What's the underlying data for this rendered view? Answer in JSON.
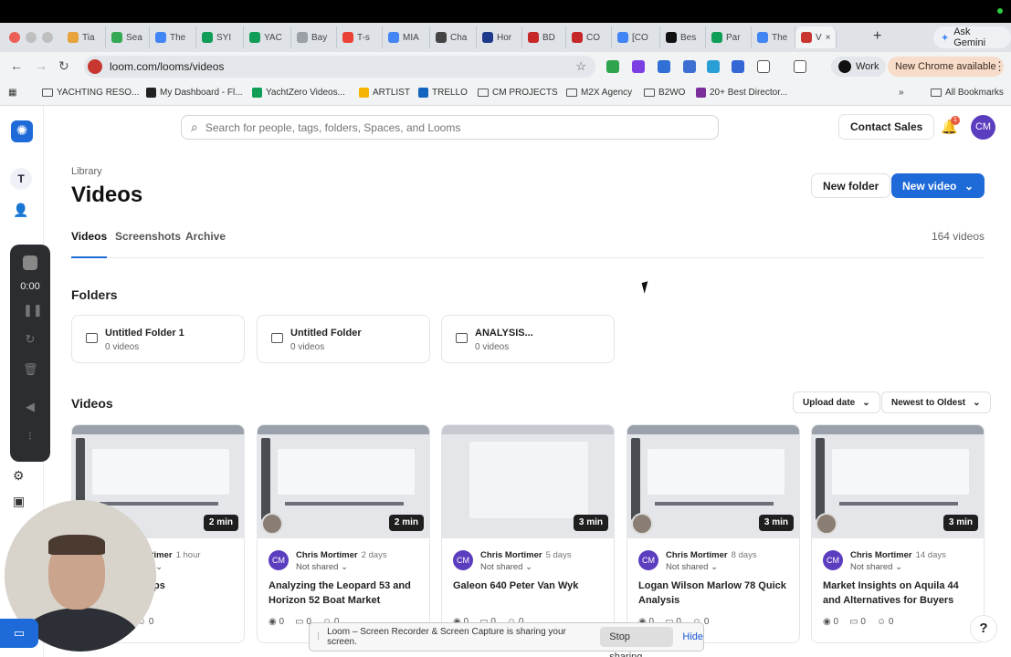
{
  "browser": {
    "tabs": [
      {
        "label": "Tia",
        "color": "#e8a33d"
      },
      {
        "label": "Sea",
        "color": "#34a853"
      },
      {
        "label": "The",
        "color": "#4285f4"
      },
      {
        "label": "SYI",
        "color": "#0f9d58"
      },
      {
        "label": "YAC",
        "color": "#0f9d58"
      },
      {
        "label": "Bay",
        "color": "#9aa0a6"
      },
      {
        "label": "T-s",
        "color": "#ea4335"
      },
      {
        "label": "MIA",
        "color": "#4285f4"
      },
      {
        "label": "Cha",
        "color": "#444444"
      },
      {
        "label": "Hor",
        "color": "#1e3a8a"
      },
      {
        "label": "BD",
        "color": "#c62828"
      },
      {
        "label": "CO",
        "color": "#c62828"
      },
      {
        "label": "[CO",
        "color": "#4285f4"
      },
      {
        "label": "Bes",
        "color": "#111111"
      },
      {
        "label": "Par",
        "color": "#0f9d58"
      },
      {
        "label": "The",
        "color": "#4285f4"
      },
      {
        "label": "V",
        "color": "#c7372f",
        "active": true
      }
    ],
    "ask_gemini": "Ask Gemini",
    "url": "loom.com/looms/videos",
    "profile": "Work",
    "update_notice": "New Chrome available",
    "bookmarks": [
      {
        "label": "YACHTING RESO...",
        "icon": "folder-icon"
      },
      {
        "label": "My Dashboard - Fl...",
        "icon": "asterisk-icon"
      },
      {
        "label": "YachtZero Videos...",
        "icon": "sheets-icon"
      },
      {
        "label": "ARTLIST",
        "icon": "artlist-icon"
      },
      {
        "label": "TRELLO",
        "icon": "trello-icon"
      },
      {
        "label": "CM PROJECTS",
        "icon": "folder-icon"
      },
      {
        "label": "M2X Agency",
        "icon": "folder-icon"
      },
      {
        "label": "B2WO",
        "icon": "folder-icon"
      },
      {
        "label": "20+ Best Director...",
        "icon": "site-icon"
      }
    ],
    "all_bookmarks": "All Bookmarks"
  },
  "sidebar": {
    "workspace_initial": "T"
  },
  "recorder": {
    "time": "0:00"
  },
  "header": {
    "search_placeholder": "Search for people, tags, folders, Spaces, and Looms",
    "contact_sales": "Contact Sales",
    "notification_count": "1",
    "user_initials": "CM"
  },
  "main": {
    "breadcrumb": "Library",
    "title": "Videos",
    "new_folder": "New folder",
    "new_video": "New video",
    "tabs": [
      {
        "label": "Videos",
        "active": true
      },
      {
        "label": "Screenshots",
        "active": false
      },
      {
        "label": "Archive",
        "active": false
      }
    ],
    "video_count": "164 videos",
    "folders_heading": "Folders",
    "folders": [
      {
        "name": "Untitled Folder 1",
        "count": "0 videos"
      },
      {
        "name": "Untitled Folder",
        "count": "0 videos"
      },
      {
        "name": "ANALYSIS...",
        "count": "0 videos"
      }
    ],
    "videos_heading": "Videos",
    "sort_field": "Upload date",
    "sort_order": "Newest to Oldest",
    "videos": [
      {
        "duration": "2 min",
        "author": "Chris Mortimer",
        "time": "1 hour",
        "sharing": "Not shared",
        "title": "...nd Sold Comps",
        "title_line2": "",
        "views": "0",
        "comments": "0",
        "reactions": "0"
      },
      {
        "duration": "2 min",
        "author": "Chris Mortimer",
        "time": "2 days",
        "sharing": "Not shared",
        "title": "Analyzing the Leopard 53 and",
        "title_line2": "Horizon 52 Boat Market",
        "views": "0",
        "comments": "0",
        "reactions": "0"
      },
      {
        "duration": "3 min",
        "author": "Chris Mortimer",
        "time": "5 days",
        "sharing": "Not shared",
        "title": "Galeon 640 Peter Van Wyk",
        "title_line2": "",
        "views": "0",
        "comments": "0",
        "reactions": "0"
      },
      {
        "duration": "3 min",
        "author": "Chris Mortimer",
        "time": "8 days",
        "sharing": "Not shared",
        "title": "Logan Wilson Marlow 78 Quick",
        "title_line2": "Analysis",
        "views": "0",
        "comments": "0",
        "reactions": "0"
      },
      {
        "duration": "3 min",
        "author": "Chris Mortimer",
        "time": "14 days",
        "sharing": "Not shared",
        "title": "Market Insights on Aquila 44",
        "title_line2": "and Alternatives for Buyers",
        "views": "0",
        "comments": "0",
        "reactions": "0"
      }
    ]
  },
  "share_bar": {
    "message": "Loom – Screen Recorder & Screen Capture is sharing your screen.",
    "stop": "Stop sharing",
    "hide": "Hide"
  },
  "colors": {
    "accent": "#1e6ad8",
    "avatar": "#5b3dbf"
  }
}
